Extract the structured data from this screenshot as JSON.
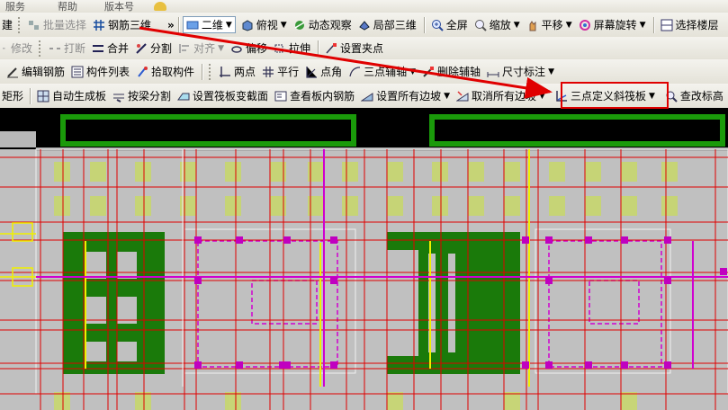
{
  "menu": {
    "items": [
      "服务",
      "帮助",
      "版本号"
    ]
  },
  "toolbar1": {
    "partial_left": "建",
    "batch_select": "批量选择",
    "rebar_3d": "钢筋三维",
    "view_mode": "二维",
    "top_view": "俯视",
    "dynamic_observe": "动态观察",
    "local_3d": "局部三维",
    "fullscreen": "全屏",
    "zoom": "缩放",
    "pan": "平移",
    "screen_rotate": "屏幕旋转",
    "select_floor": "选择楼层"
  },
  "toolbar2": {
    "modify": "修改",
    "break": "打断",
    "merge": "合并",
    "split": "分割",
    "align": "对齐",
    "offset": "偏移",
    "stretch": "拉伸",
    "set_grip": "设置夹点"
  },
  "toolbar3": {
    "edit_rebar": "编辑钢筋",
    "component_list": "构件列表",
    "pick_component": "拾取构件",
    "two_points": "两点",
    "parallel": "平行",
    "point_angle": "点角",
    "three_point_axis": "三点辅轴",
    "delete_axis": "删除辅轴",
    "dimension": "尺寸标注"
  },
  "toolbar4": {
    "partial_rect": "矩形",
    "auto_generate_slab": "自动生成板",
    "split_by_beam": "按梁分割",
    "set_raft_section": "设置筏板变截面",
    "view_slab_rebar": "查看板内钢筋",
    "set_all_slopes": "设置所有边坡",
    "cancel_all_slopes": "取消所有边坡",
    "three_point_slope_raft": "三点定义斜筏板",
    "check_elevation": "查改标高"
  },
  "colors": {
    "canvas_bg": "#c0c0c0",
    "grid_red": "#e00000",
    "footing_green": "#1a7a0a",
    "magenta": "#d000d0",
    "yellow": "#f0f000",
    "highlight": "#e00000"
  }
}
